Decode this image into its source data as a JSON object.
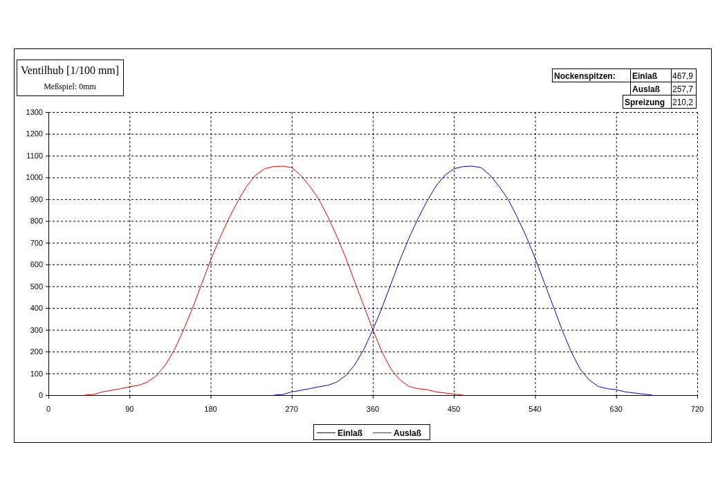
{
  "title_box": {
    "title": "Ventilhub [1/100 mm]",
    "subtitle": "Meßspiel: 0mm"
  },
  "peaks_table": {
    "heading": "Nockenspitzen:",
    "rows": [
      {
        "label": "Einlaß",
        "value": "467,9"
      },
      {
        "label": "Auslaß",
        "value": "257,7"
      },
      {
        "label": "Spreizung",
        "value": "210,2"
      }
    ]
  },
  "chart_data": {
    "type": "line",
    "x": [
      40,
      50,
      60,
      70,
      80,
      90,
      100,
      110,
      120,
      130,
      140,
      150,
      160,
      170,
      180,
      190,
      200,
      210,
      220,
      230,
      240,
      250,
      260,
      270,
      280,
      290,
      300,
      310,
      320,
      330,
      340,
      350,
      360,
      370,
      380,
      390,
      400,
      410,
      420,
      430,
      440,
      450,
      460,
      470,
      480,
      490,
      500,
      510,
      520,
      530,
      540,
      550,
      560,
      570,
      580,
      590,
      600,
      610,
      620,
      630,
      640,
      650,
      660,
      670
    ],
    "series": [
      {
        "name": "Einlaß",
        "color": "#0000c0",
        "values": [
          null,
          null,
          null,
          null,
          null,
          null,
          null,
          null,
          null,
          null,
          null,
          null,
          null,
          null,
          null,
          null,
          null,
          null,
          null,
          null,
          null,
          0,
          3,
          15,
          22,
          30,
          38,
          45,
          60,
          90,
          140,
          210,
          300,
          400,
          510,
          620,
          720,
          810,
          890,
          960,
          1010,
          1040,
          1050,
          1052,
          1045,
          1010,
          960,
          900,
          820,
          730,
          630,
          520,
          410,
          300,
          200,
          120,
          70,
          40,
          30,
          25,
          15,
          10,
          5,
          0
        ]
      },
      {
        "name": "Auslaß",
        "color": "#e00000",
        "values": [
          0,
          3,
          15,
          22,
          30,
          38,
          45,
          60,
          90,
          140,
          210,
          300,
          400,
          510,
          620,
          720,
          810,
          890,
          960,
          1010,
          1040,
          1050,
          1052,
          1045,
          1010,
          960,
          900,
          820,
          730,
          630,
          520,
          410,
          300,
          200,
          120,
          70,
          40,
          30,
          25,
          15,
          10,
          5,
          0,
          null,
          null,
          null,
          null,
          null,
          null,
          null,
          null,
          null,
          null,
          null,
          null,
          null,
          null,
          null,
          null,
          null,
          null,
          null,
          null,
          null
        ]
      }
    ],
    "xlim": [
      0,
      720
    ],
    "ylim": [
      0,
      1300
    ],
    "xticks": [
      0,
      90,
      180,
      270,
      360,
      450,
      540,
      630,
      720
    ],
    "yticks": [
      0,
      100,
      200,
      300,
      400,
      500,
      600,
      700,
      800,
      900,
      1000,
      1100,
      1200,
      1300
    ],
    "grid": true,
    "legend": true
  }
}
